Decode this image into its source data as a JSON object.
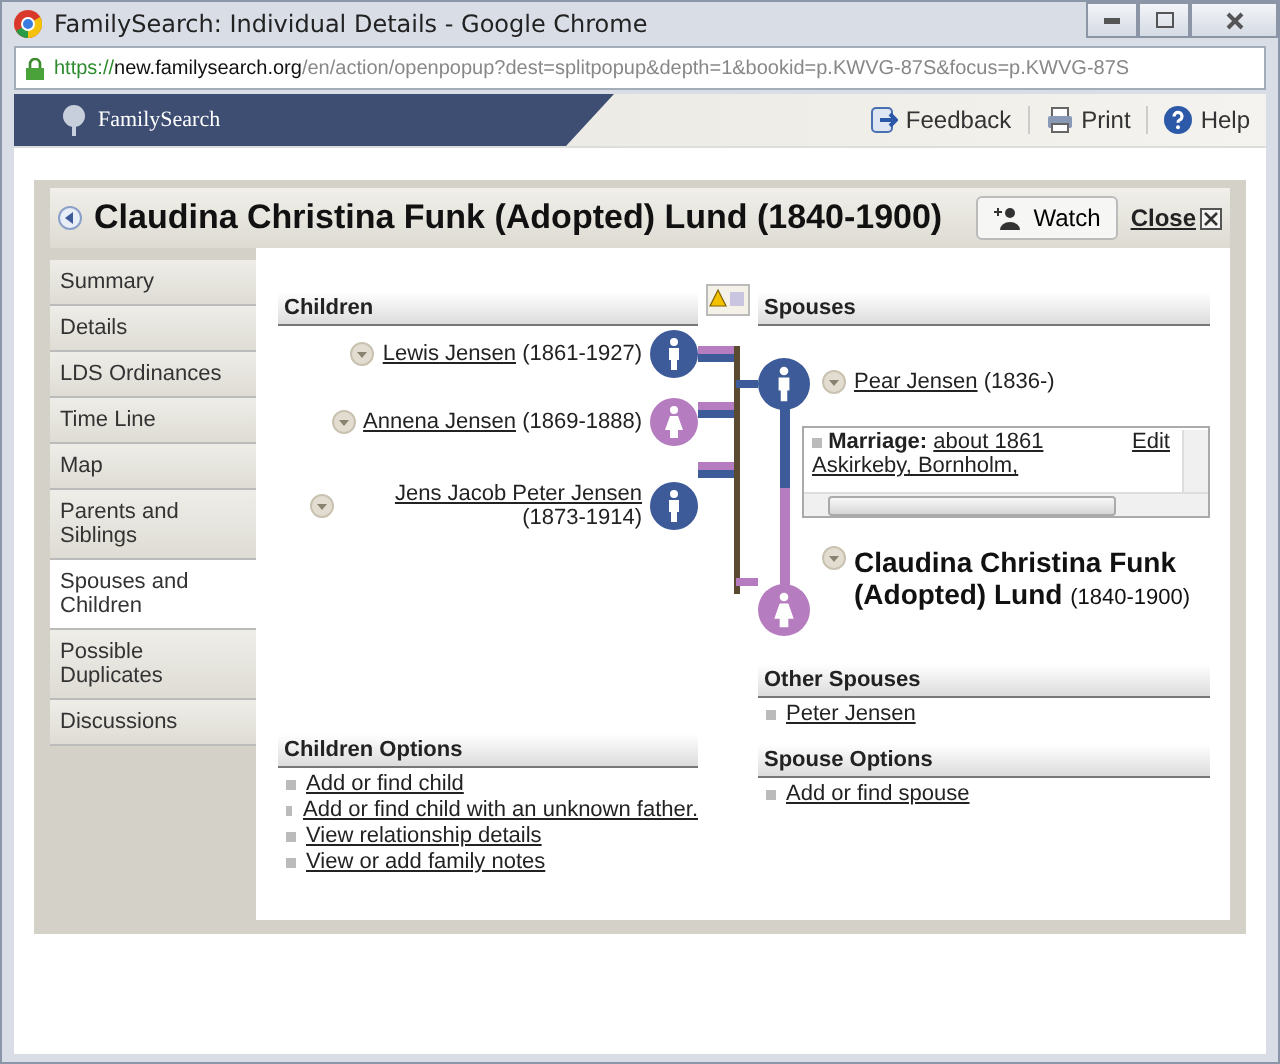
{
  "window": {
    "title": "FamilySearch: Individual Details - Google Chrome"
  },
  "address_bar": {
    "scheme": "https://",
    "host": "new.familysearch.org",
    "path": "/en/action/openpopup?dest=splitpopup&depth=1&bookid=p.KWVG-87S&focus=p.KWVG-87S"
  },
  "site_header": {
    "logo": "FamilySearch",
    "links": [
      "Feedback",
      "Print",
      "Help"
    ]
  },
  "dialog": {
    "title": "Claudina Christina Funk (Adopted) Lund (1840-1900)",
    "watch_button": "Watch",
    "close_link": "Close"
  },
  "sidebar": {
    "items": [
      {
        "label": "Summary",
        "selected": false
      },
      {
        "label": "Details",
        "selected": false
      },
      {
        "label": "LDS Ordinances",
        "selected": false
      },
      {
        "label": "Time Line",
        "selected": false
      },
      {
        "label": "Map",
        "selected": false
      },
      {
        "label": "Parents and Siblings",
        "selected": false
      },
      {
        "label": "Spouses and Children",
        "selected": true
      },
      {
        "label": "Possible Duplicates",
        "selected": false
      },
      {
        "label": "Discussions",
        "selected": false
      }
    ]
  },
  "children": {
    "heading": "Children",
    "items": [
      {
        "name": "Lewis Jensen",
        "years": "(1861-1927)",
        "kind": "male"
      },
      {
        "name": "Annena Jensen",
        "years": "(1869-1888)",
        "kind": "female"
      },
      {
        "name": "Jens Jacob Peter Jensen",
        "years": "(1873-1914)",
        "kind": "male"
      }
    ]
  },
  "spouses": {
    "heading": "Spouses",
    "spouse": {
      "name": "Pear Jensen",
      "years": "(1836-)",
      "kind": "male"
    },
    "marriage": {
      "label": "Marriage:",
      "date": "about 1861",
      "place": "Askirkeby, Bornholm,",
      "edit": "Edit"
    },
    "self": {
      "name": "Claudina Christina Funk (Adopted) Lund",
      "years": "(1840-1900)",
      "kind": "female"
    }
  },
  "other_spouses": {
    "heading": "Other Spouses",
    "items": [
      "Peter Jensen"
    ]
  },
  "children_options": {
    "heading": "Children Options",
    "items": [
      "Add or find child",
      "Add or find child with an unknown father.",
      "View relationship details",
      "View or add family notes"
    ]
  },
  "spouse_options": {
    "heading": "Spouse Options",
    "items": [
      "Add or find spouse"
    ]
  }
}
